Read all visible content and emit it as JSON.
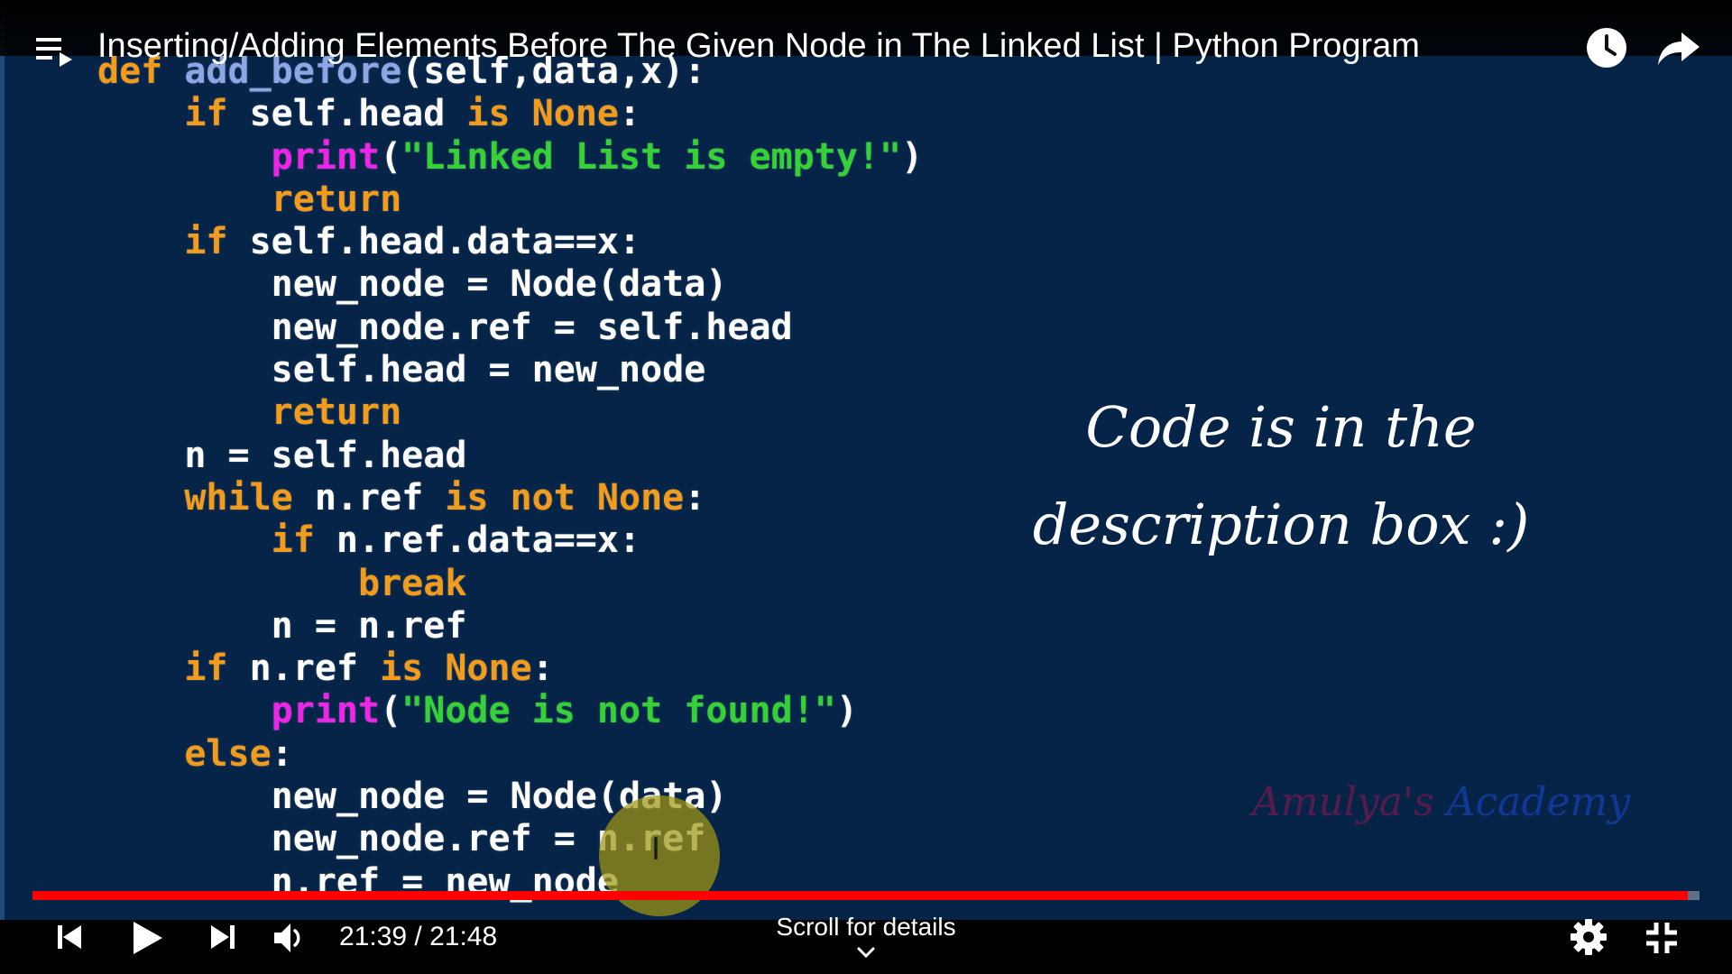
{
  "video": {
    "title": "Inserting/Adding Elements Before The Given Node in The Linked List | Python Program",
    "code_lines": [
      [
        {
          "t": "def ",
          "c": "kw"
        },
        {
          "t": "add_before",
          "c": "fn"
        },
        {
          "t": "(self,data,x):",
          "c": ""
        }
      ],
      [
        {
          "t": "    if ",
          "c": "kw"
        },
        {
          "t": "self.head ",
          "c": ""
        },
        {
          "t": "is None",
          "c": "kw"
        },
        {
          "t": ":",
          "c": ""
        }
      ],
      [
        {
          "t": "        print",
          "c": "pr"
        },
        {
          "t": "(",
          "c": ""
        },
        {
          "t": "\"Linked List is empty!\"",
          "c": "st"
        },
        {
          "t": ")",
          "c": ""
        }
      ],
      [
        {
          "t": "        return",
          "c": "kw"
        }
      ],
      [
        {
          "t": "    if ",
          "c": "kw"
        },
        {
          "t": "self.head.data==x:",
          "c": ""
        }
      ],
      [
        {
          "t": "        new_node = Node(data)",
          "c": ""
        }
      ],
      [
        {
          "t": "        new_node.ref = self.head",
          "c": ""
        }
      ],
      [
        {
          "t": "        self.head = new_node",
          "c": ""
        }
      ],
      [
        {
          "t": "        return",
          "c": "kw"
        }
      ],
      [
        {
          "t": "    n = self.head",
          "c": ""
        }
      ],
      [
        {
          "t": "    while ",
          "c": "kw"
        },
        {
          "t": "n.ref ",
          "c": ""
        },
        {
          "t": "is not None",
          "c": "kw"
        },
        {
          "t": ":",
          "c": ""
        }
      ],
      [
        {
          "t": "        if ",
          "c": "kw"
        },
        {
          "t": "n.ref.data==x:",
          "c": ""
        }
      ],
      [
        {
          "t": "            break",
          "c": "kw"
        }
      ],
      [
        {
          "t": "        n = n.ref",
          "c": ""
        }
      ],
      [
        {
          "t": "    if ",
          "c": "kw"
        },
        {
          "t": "n.ref ",
          "c": ""
        },
        {
          "t": "is None",
          "c": "kw"
        },
        {
          "t": ":",
          "c": ""
        }
      ],
      [
        {
          "t": "        print",
          "c": "pr"
        },
        {
          "t": "(",
          "c": ""
        },
        {
          "t": "\"Node is not found!\"",
          "c": "st"
        },
        {
          "t": ")",
          "c": ""
        }
      ],
      [
        {
          "t": "    else",
          "c": "kw"
        },
        {
          "t": ":",
          "c": ""
        }
      ],
      [
        {
          "t": "        new_node = Node(data)",
          "c": ""
        }
      ],
      [
        {
          "t": "        new_node.ref = n.ref",
          "c": ""
        }
      ],
      [
        {
          "t": "        n.ref = new_node",
          "c": ""
        }
      ]
    ],
    "note_line1": "Code is in the",
    "note_line2": "description box :)",
    "watermark_part1": "Amulya's",
    "watermark_part2": " Academy"
  },
  "player": {
    "time_display": "21:39 / 21:48",
    "progress_fraction": 0.993,
    "scroll_hint": "Scroll for details"
  },
  "icons": {
    "playlist": "playlist-icon",
    "watch_later": "clock-icon",
    "share": "share-arrow-icon",
    "prev": "skip-previous-icon",
    "play": "play-icon",
    "next": "skip-next-icon",
    "volume": "volume-icon",
    "settings": "gear-icon",
    "exit_fullscreen": "exit-fullscreen-icon",
    "scroll": "chevron-down-icon"
  },
  "colors": {
    "slide_background": "#052448",
    "keyword": "#f39b1a",
    "function_name": "#8fa6e6",
    "print_builtin": "#f024e8",
    "string": "#35d235",
    "progress": "#ff0000"
  }
}
